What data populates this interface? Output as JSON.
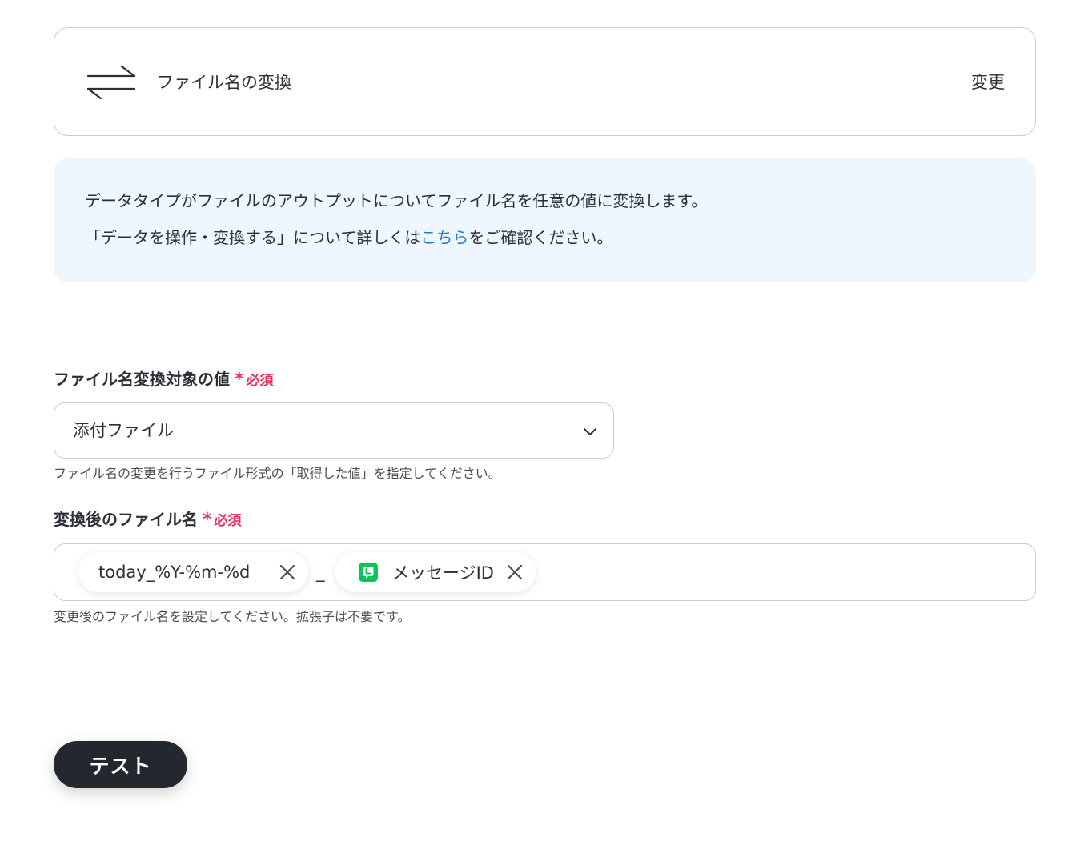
{
  "operation": {
    "title": "ファイル名の変換",
    "change_label": "変更",
    "icon": "arrows-exchange-icon"
  },
  "info": {
    "line1": "データタイプがファイルのアウトプットについてファイル名を任意の値に変換します。",
    "line2_prefix": "「データを操作・変換する」について詳しくは",
    "line2_link": "こちら",
    "line2_suffix": "をご確認ください。"
  },
  "field_target": {
    "label": "ファイル名変換対象の値",
    "required_mark": "*",
    "required_label": "必須",
    "value": "添付ファイル",
    "help": "ファイル名の変更を行うファイル形式の「取得した値」を指定してください。"
  },
  "field_filename": {
    "label": "変換後のファイル名",
    "required_mark": "*",
    "required_label": "必須",
    "chips": [
      {
        "text": "today_%Y-%m-%d",
        "icon": null
      },
      {
        "text": "メッセージID",
        "icon": "line-app-icon"
      }
    ],
    "separator": "_",
    "help": "変更後のファイル名を設定してください。拡張子は不要です。"
  },
  "test_button": {
    "label": "テスト"
  },
  "colors": {
    "accent_link": "#1f7bd8",
    "required": "#e0315a",
    "info_bg": "#eff6fe",
    "button_bg": "#23272e",
    "line_green": "#06c755"
  }
}
